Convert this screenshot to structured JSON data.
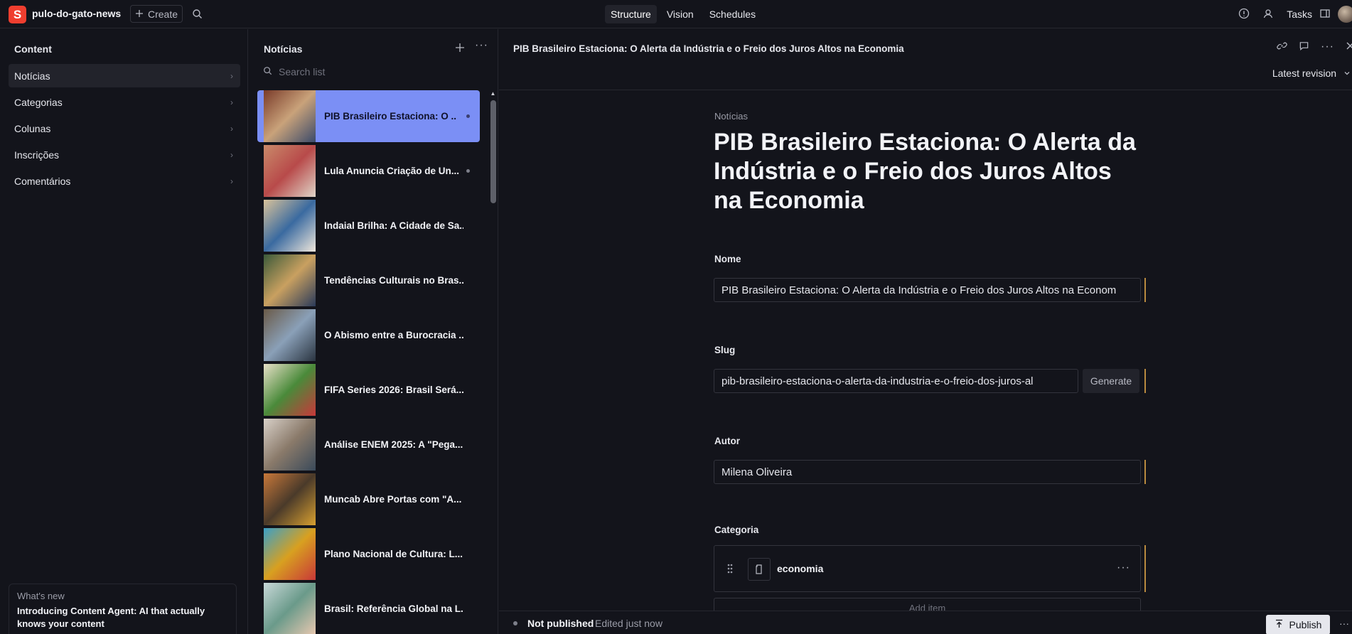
{
  "app": {
    "logo_letter": "S",
    "project_name": "pulo-do-gato-news",
    "create_label": "Create",
    "tabs": [
      {
        "label": "Structure",
        "active": true
      },
      {
        "label": "Vision",
        "active": false
      },
      {
        "label": "Schedules",
        "active": false
      }
    ],
    "tasks_label": "Tasks"
  },
  "left_pane": {
    "title": "Content",
    "items": [
      {
        "label": "Notícias",
        "active": true
      },
      {
        "label": "Categorias",
        "active": false
      },
      {
        "label": "Colunas",
        "active": false
      },
      {
        "label": "Inscrições",
        "active": false
      },
      {
        "label": "Comentários",
        "active": false
      }
    ],
    "whats_new": {
      "label": "What's new",
      "text": "Introducing Content Agent: AI that actually knows your content"
    }
  },
  "mid_pane": {
    "title": "Notícias",
    "search_placeholder": "Search list",
    "documents": [
      {
        "label": "PIB Brasileiro Estaciona: O ...",
        "active": true,
        "has_dot": true,
        "thumb": [
          "#7a3b2a",
          "#c9a27a",
          "#3b4a6a"
        ]
      },
      {
        "label": "Lula Anuncia Criação de Un...",
        "active": false,
        "has_dot": true,
        "thumb": [
          "#c98a6a",
          "#b84a4a",
          "#e0d6c9"
        ]
      },
      {
        "label": "Indaial Brilha: A Cidade de Sa...",
        "active": false,
        "has_dot": false,
        "thumb": [
          "#d9c29a",
          "#3a6aa0",
          "#f0e8dc"
        ]
      },
      {
        "label": "Tendências Culturais no Bras...",
        "active": false,
        "has_dot": false,
        "thumb": [
          "#3b5a3a",
          "#c9a060",
          "#2a3a5a"
        ]
      },
      {
        "label": "O Abismo entre a Burocracia ...",
        "active": false,
        "has_dot": false,
        "thumb": [
          "#6a5a48",
          "#8aa0b8",
          "#2a3440"
        ]
      },
      {
        "label": "FIFA Series 2026: Brasil Será...",
        "active": false,
        "has_dot": false,
        "thumb": [
          "#e8e0c8",
          "#4a8a3a",
          "#c8383a"
        ]
      },
      {
        "label": "Análise ENEM 2025: A \"Pega...",
        "active": false,
        "has_dot": false,
        "thumb": [
          "#d8d0c8",
          "#8a7a6a",
          "#3a4a5a"
        ]
      },
      {
        "label": "Muncab Abre Portas com \"A...",
        "active": false,
        "has_dot": false,
        "thumb": [
          "#c8783a",
          "#4a3a2a",
          "#d8a030"
        ]
      },
      {
        "label": "Plano Nacional de Cultura: L...",
        "active": false,
        "has_dot": false,
        "thumb": [
          "#3aa0c8",
          "#d8a020",
          "#c83838"
        ]
      },
      {
        "label": "Brasil: Referência Global na L...",
        "active": false,
        "has_dot": false,
        "thumb": [
          "#c8d8d8",
          "#6a9a8a",
          "#e8c8b0"
        ]
      }
    ]
  },
  "editor": {
    "doc_title": "PIB Brasileiro Estaciona: O Alerta da Indústria e o Freio dos Juros Altos na Economia",
    "revision_label": "Latest revision",
    "breadcrumb": "Notícias",
    "heading": "PIB Brasileiro Estaciona: O Alerta da Indústria e o Freio dos Juros Altos na Economia",
    "fields": {
      "nome": {
        "label": "Nome",
        "value": "PIB Brasileiro Estaciona: O Alerta da Indústria e o Freio dos Juros Altos na Econom"
      },
      "slug": {
        "label": "Slug",
        "value": "pib-brasileiro-estaciona-o-alerta-da-industria-e-o-freio-dos-juros-al",
        "generate_label": "Generate"
      },
      "autor": {
        "label": "Autor",
        "value": "Milena Oliveira"
      },
      "categoria": {
        "label": "Categoria",
        "value": "economia"
      }
    },
    "add_item_label": "Add item"
  },
  "footer": {
    "status": "Not published",
    "edited": "Edited just now",
    "publish_label": "Publish"
  },
  "colors": {
    "accent": "#7b8ff5",
    "brand": "#f03e2f",
    "changed_marker": "#b98a3f"
  }
}
